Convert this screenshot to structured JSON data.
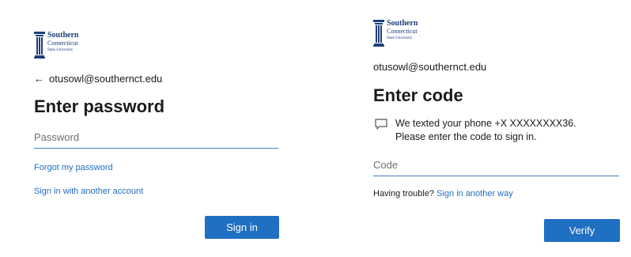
{
  "password_screen": {
    "logo": {
      "line1": "Southern",
      "line2": "Connecticut",
      "line3": "State University"
    },
    "back_icon": "back-arrow-icon",
    "back_glyph": "←",
    "identity": "otusowl@southernct.edu",
    "title": "Enter password",
    "password_placeholder": "Password",
    "forgot_link": "Forgot my password",
    "other_account_link": "Sign in with another account",
    "signin_button": "Sign in"
  },
  "code_screen": {
    "logo": {
      "line1": "Southern",
      "line2": "Connecticut",
      "line3": "State University"
    },
    "identity": "otusowl@southernct.edu",
    "title": "Enter code",
    "message_icon": "message-icon",
    "message_line1": "We texted your phone +X XXXXXXXX36.",
    "message_line2": "Please enter the code to sign in.",
    "code_placeholder": "Code",
    "trouble_text": "Having trouble?",
    "another_way_link": "Sign in another way",
    "verify_button": "Verify"
  },
  "colors": {
    "accent": "#1f6fc2",
    "field_underline": "#3f7fc7",
    "logo_blue": "#1e3f78",
    "text": "#1b1b1b"
  }
}
